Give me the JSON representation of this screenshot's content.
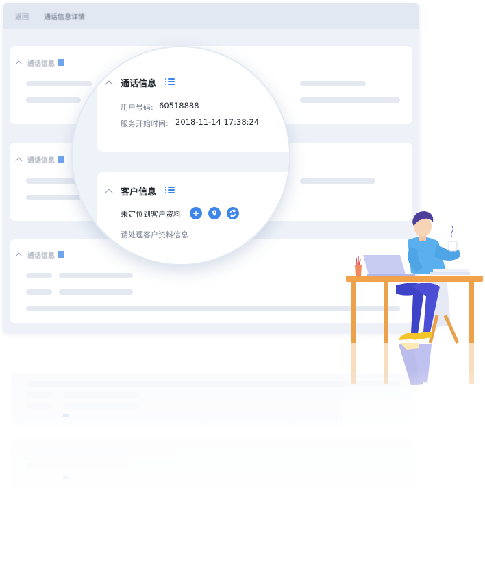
{
  "background_window": {
    "header": {
      "back_label": "返回",
      "title": "通话信息详情"
    },
    "cards": [
      {
        "title": "通话信息"
      },
      {
        "title": "通话信息"
      },
      {
        "title": "通话信息"
      }
    ]
  },
  "magnifier": {
    "call_info": {
      "title": "通话信息",
      "user_number_label": "用户号码:",
      "user_number_value": "60518888",
      "service_start_label": "服务开始时间:",
      "service_start_value": "2018-11-14 17:38:24"
    },
    "customer_info": {
      "title": "客户信息",
      "status_text": "未定位到客户资料",
      "hint_text": "请处理客户资料信息",
      "buttons": [
        {
          "icon": "plus-icon",
          "glyph": "+"
        },
        {
          "icon": "location-pin-icon"
        },
        {
          "icon": "refresh-icon"
        }
      ]
    }
  },
  "colors": {
    "accent": "#3f86ea",
    "card_bg": "#ffffff",
    "window_bg": "#eef2f8",
    "skeleton": "#e4e9f1",
    "desk": "#f2a24a",
    "shirt": "#5ab0ee",
    "pants": "#3d44c8",
    "hair": "#4b3f9a",
    "laptop": "#c9ccf2"
  }
}
